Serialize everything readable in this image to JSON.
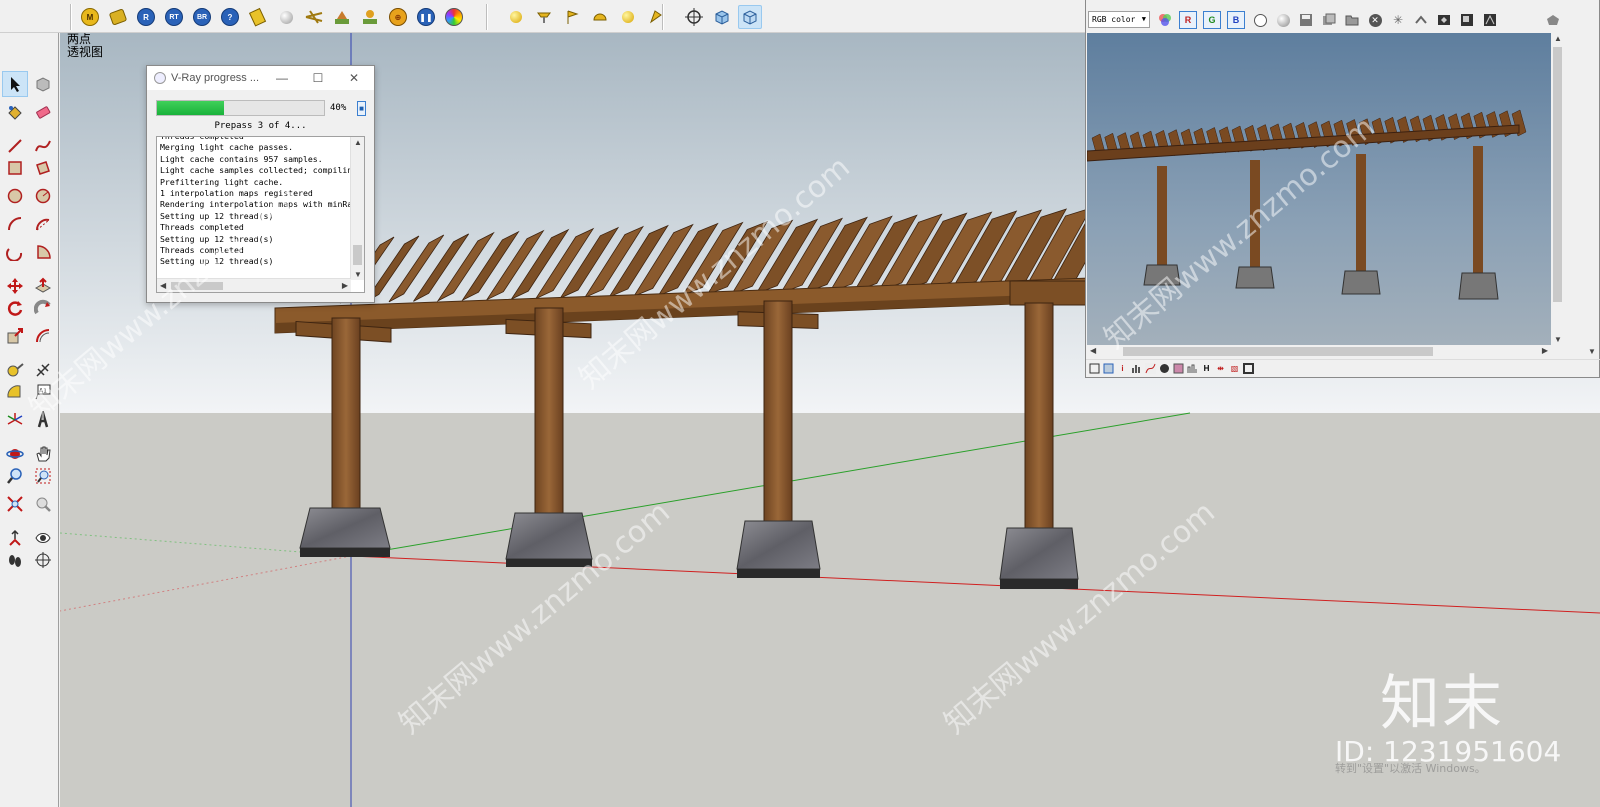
{
  "viewport": {
    "view_label_line1": "两点",
    "view_label_line2": "透视图"
  },
  "top_toolbar": {
    "vray_icons": [
      "vray-material-editor-icon",
      "vray-options-icon",
      "vray-render-icon",
      "vray-rt-render-icon",
      "vray-batch-render-icon",
      "vray-help-icon",
      "vray-frame-buffer-icon",
      "vray-sphere-icon",
      "vray-camera-icon",
      "vray-sunlight-icon",
      "vray-lighting-icon",
      "vray-focus-icon",
      "vray-pause-icon",
      "vray-color-wheel-icon"
    ],
    "light_icons": [
      "omni-light-icon",
      "rectangle-light-icon",
      "spot-light-icon",
      "dome-light-icon",
      "sphere-light-icon",
      "ies-light-icon"
    ],
    "view_icons": [
      "position-camera-icon",
      "standard-view-icon",
      "iso-view-icon"
    ]
  },
  "vray_dialog": {
    "title": "V-Ray progress ...",
    "progress_percent": 40,
    "percent_label": "40%",
    "status": "Prepass 3 of 4...",
    "log_lines": [
      "Threads completed",
      "Merging light cache passes.",
      "Light cache contains 957 samples.",
      "Light cache samples collected; compiling",
      "Prefiltering light cache.",
      "1 interpolation maps registered",
      "Rendering interpolation maps with minRate",
      "Setting up 12 thread(s)",
      "Threads completed",
      "Setting up 12 thread(s)",
      "Threads completed",
      "Setting up 12 thread(s)"
    ]
  },
  "vfb": {
    "channel_select": "RGB color",
    "red_label": "R",
    "green_label": "G",
    "blue_label": "B",
    "bottom_h_label": "H"
  },
  "watermark": {
    "logo": "知末",
    "id": "ID: 1231951604",
    "activate": "转到\"设置\"以激活 Windows。",
    "diagonal": "知末网www.znzmo.com"
  },
  "colors": {
    "accent": "#3b7fd0",
    "progress": "#1db53f",
    "wood": "#8b5a2b",
    "sky_top": "#5f7f9f",
    "ground": "#cbcbc6"
  }
}
